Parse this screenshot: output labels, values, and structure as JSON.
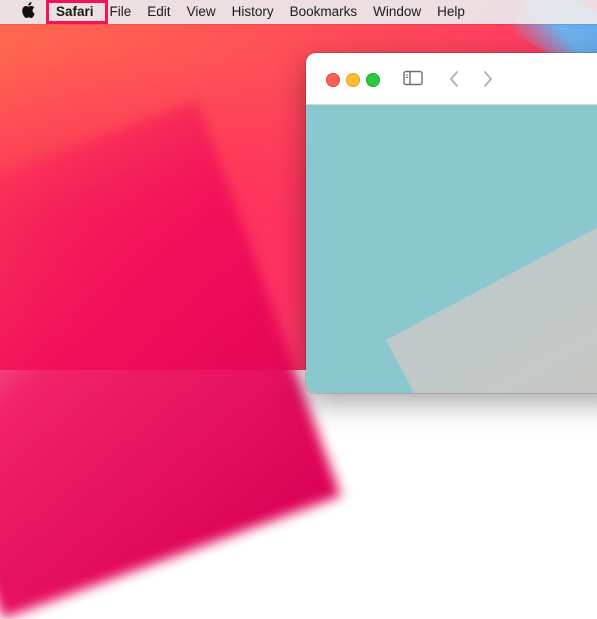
{
  "menubar": {
    "app_name": "Safari",
    "items": [
      {
        "label": "File"
      },
      {
        "label": "Edit"
      },
      {
        "label": "View"
      },
      {
        "label": "History"
      },
      {
        "label": "Bookmarks"
      },
      {
        "label": "Window"
      },
      {
        "label": "Help"
      }
    ],
    "highlight_color": "#f2135c"
  },
  "window": {
    "icons": [
      "close-icon",
      "minimize-icon",
      "maximize-icon",
      "sidebar-toggle-icon",
      "back-arrow-icon",
      "forward-arrow-icon"
    ],
    "content_color": "#8bc7ce"
  }
}
